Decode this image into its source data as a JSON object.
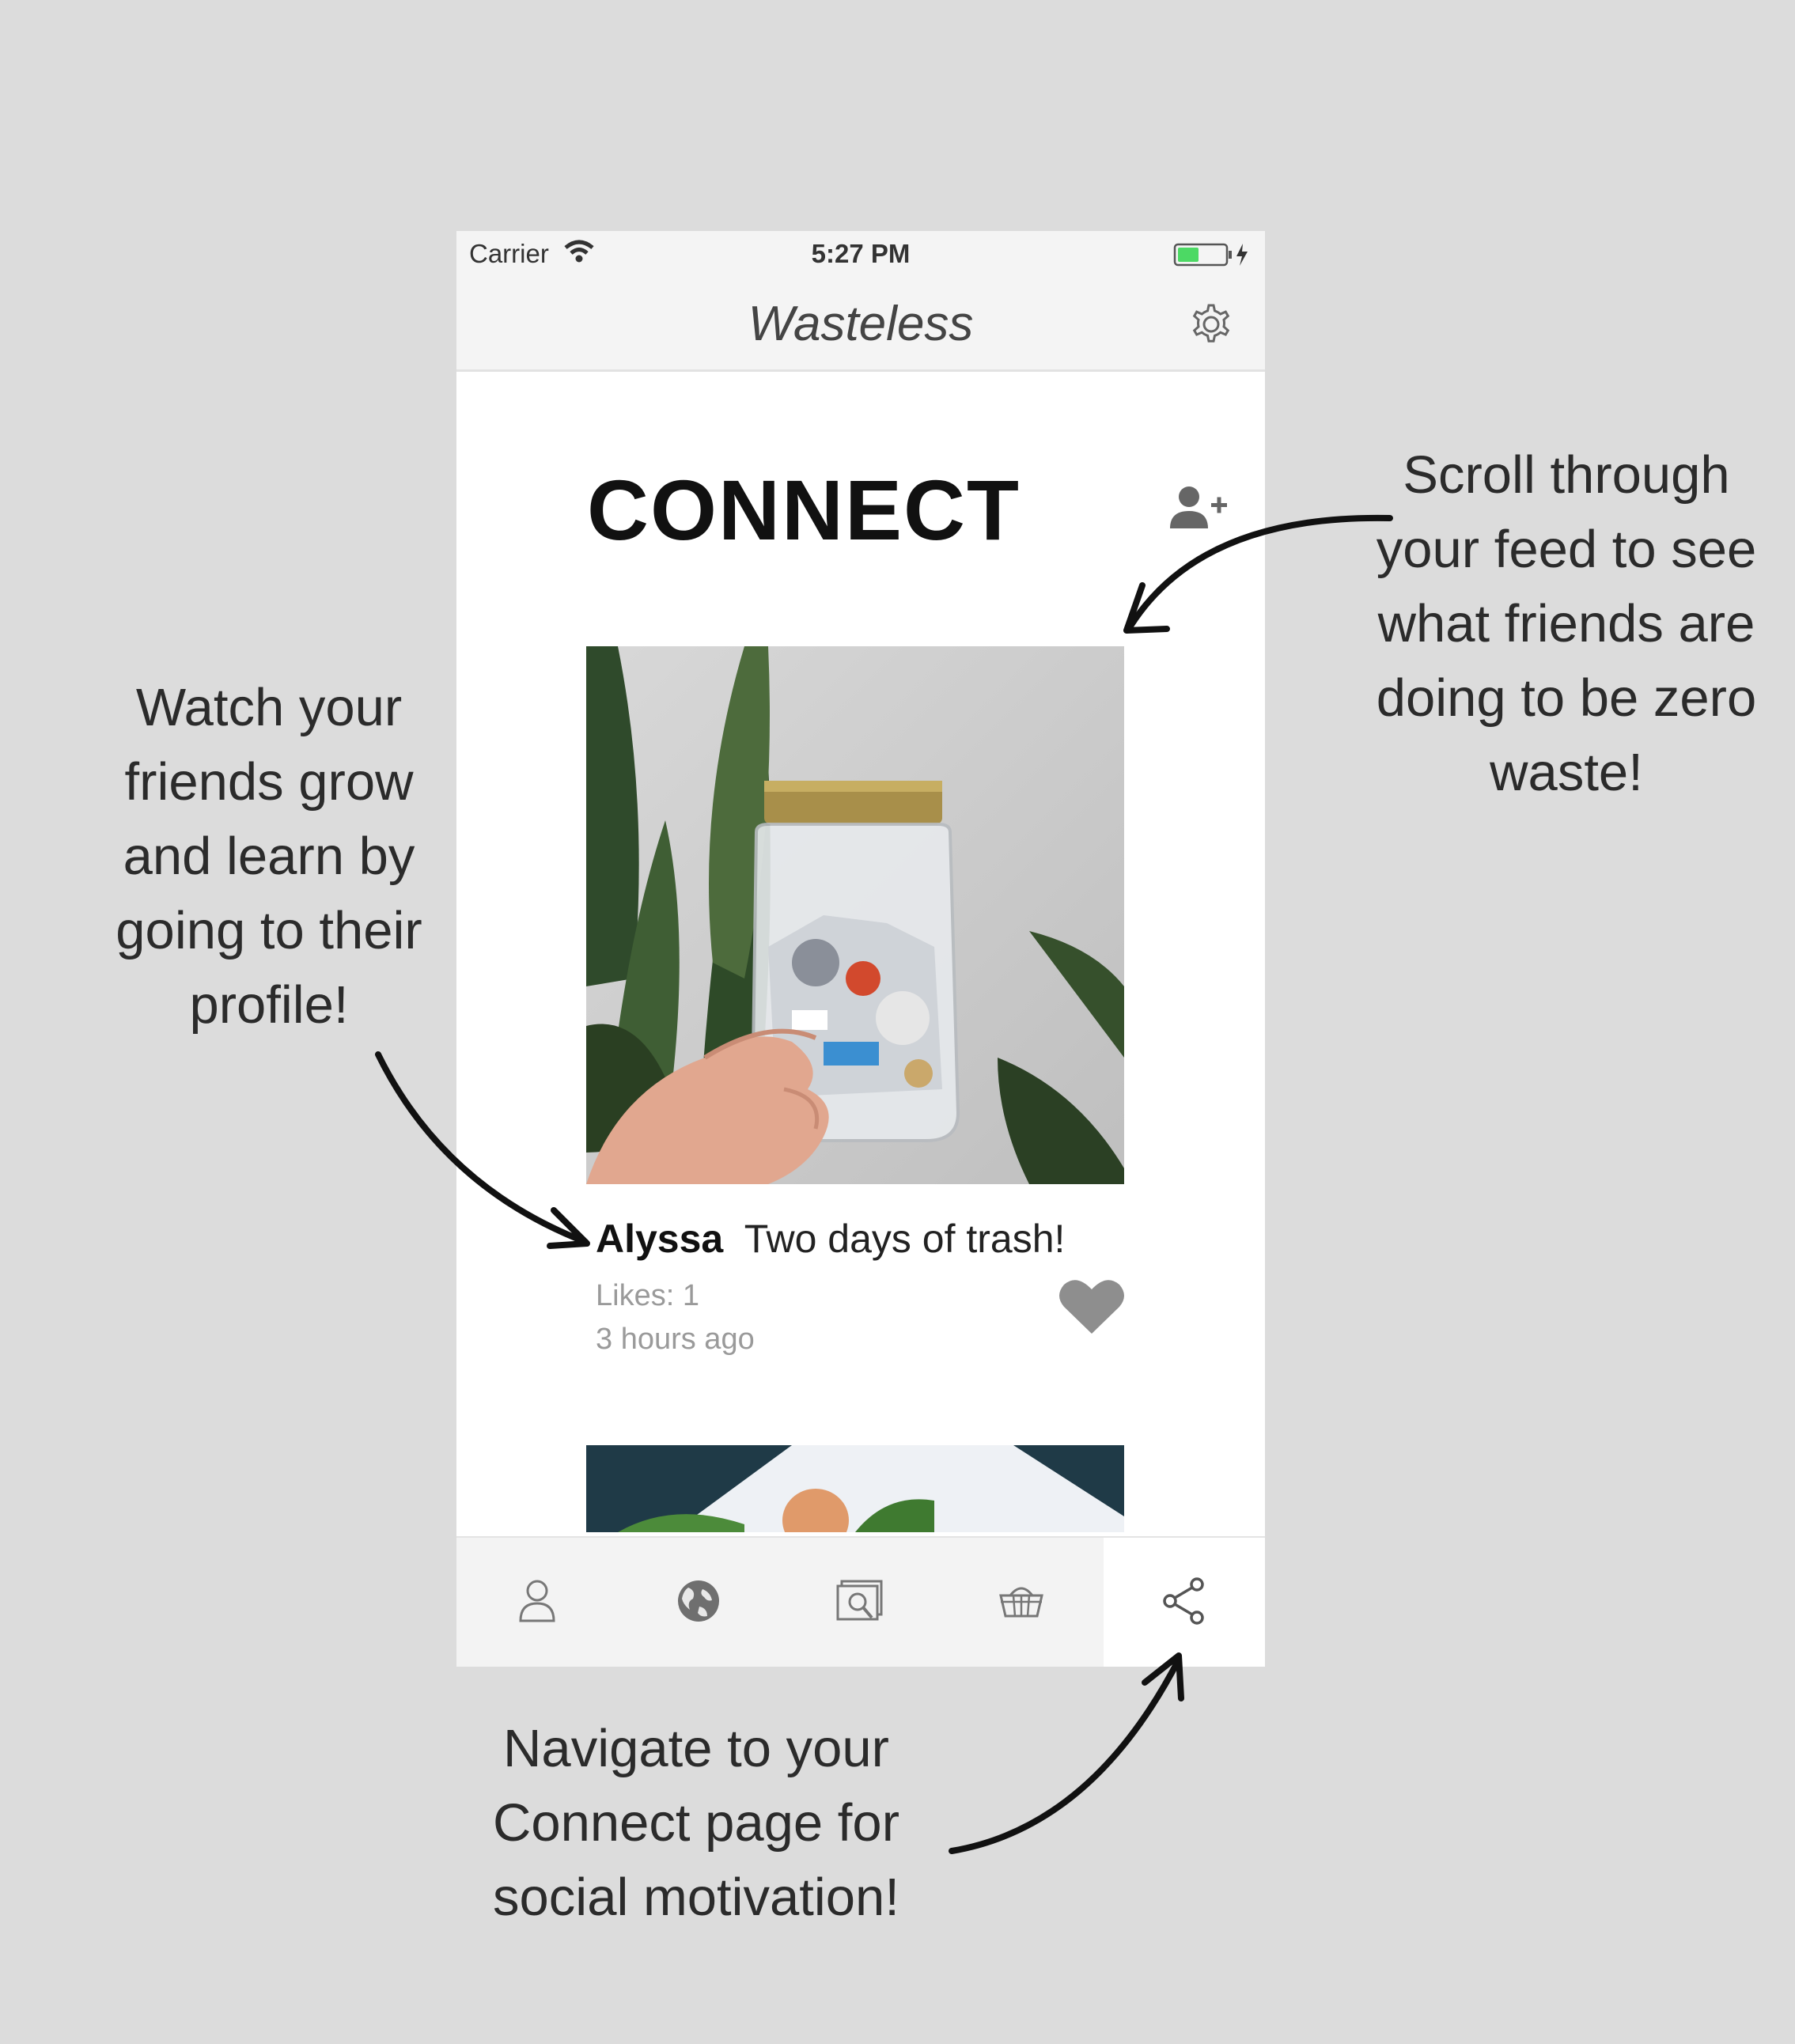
{
  "status_bar": {
    "carrier": "Carrier",
    "time": "5:27 PM"
  },
  "nav": {
    "title": "Wasteless",
    "settings_icon": "gear-icon"
  },
  "page": {
    "title": "CONNECT",
    "add_friend_icon": "add-person-icon"
  },
  "post": {
    "user": "Alyssa",
    "caption": "Two days of trash!",
    "likes": "Likes: 1",
    "time_ago": "3 hours ago",
    "like_icon": "heart-icon"
  },
  "tabs": [
    {
      "icon": "person-icon"
    },
    {
      "icon": "globe-icon"
    },
    {
      "icon": "photo-icon"
    },
    {
      "icon": "basket-icon"
    },
    {
      "icon": "share-icon",
      "active": true
    }
  ],
  "annotations": {
    "left_lines": [
      "Watch your",
      "friends grow",
      "and learn by",
      "going to their",
      "profile!"
    ],
    "right_lines": [
      "Scroll through",
      "your feed to see",
      "what friends are",
      "doing to be zero",
      "waste!"
    ],
    "bottom_lines": [
      "Navigate to your",
      "Connect page for",
      "social motivation!"
    ]
  },
  "colors": {
    "background": "#dcdcdc",
    "battery_green": "#4cd964",
    "heart_gray": "#8e8e8e"
  }
}
